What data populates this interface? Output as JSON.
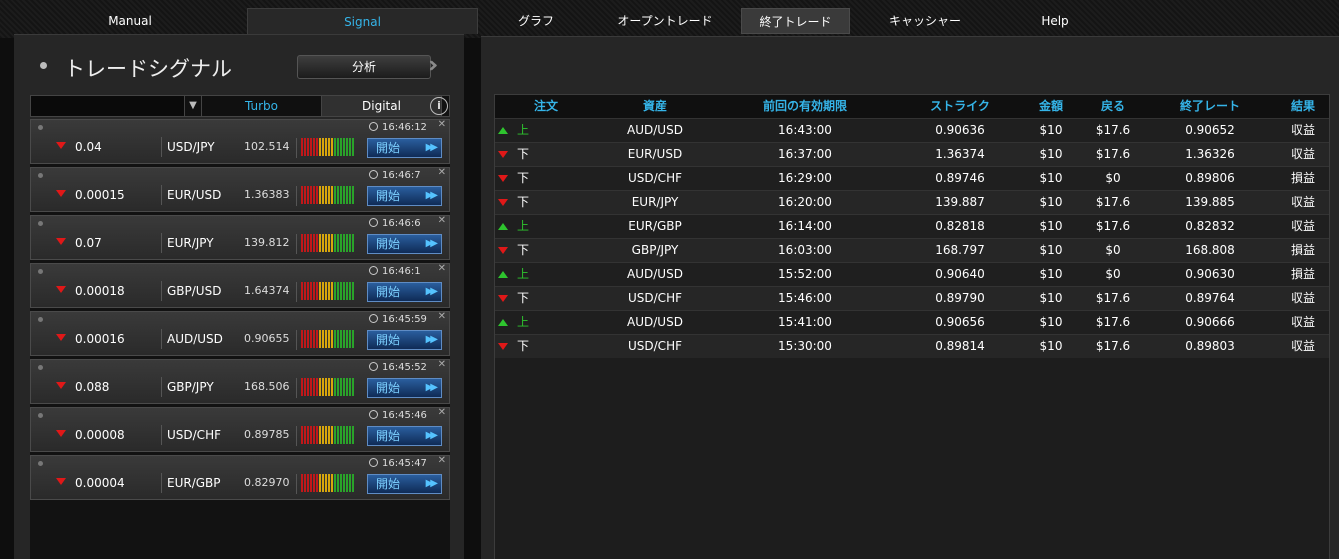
{
  "nav": {
    "tabs": [
      {
        "label": "Manual"
      },
      {
        "label": "Signal"
      },
      {
        "label": "グラフ"
      },
      {
        "label": "オープントレード"
      },
      {
        "label": "終了トレード"
      },
      {
        "label": "キャッシャー"
      },
      {
        "label": "Help"
      }
    ],
    "active_tab": "Signal",
    "selected_tab": "終了トレード"
  },
  "left_panel": {
    "title": "トレードシグナル",
    "analyze_label": "分析",
    "filter": {
      "selected": "",
      "turbo_label": "Turbo",
      "digital_label": "Digital",
      "info_label": "i"
    },
    "signals": [
      {
        "time": "16:46:12",
        "value": "0.04",
        "pair": "USD/JPY",
        "price": "102.514",
        "direction": "down",
        "start_label": "開始"
      },
      {
        "time": "16:46:7",
        "value": "0.00015",
        "pair": "EUR/USD",
        "price": "1.36383",
        "direction": "down",
        "start_label": "開始"
      },
      {
        "time": "16:46:6",
        "value": "0.07",
        "pair": "EUR/JPY",
        "price": "139.812",
        "direction": "down",
        "start_label": "開始"
      },
      {
        "time": "16:46:1",
        "value": "0.00018",
        "pair": "GBP/USD",
        "price": "1.64374",
        "direction": "down",
        "start_label": "開始"
      },
      {
        "time": "16:45:59",
        "value": "0.00016",
        "pair": "AUD/USD",
        "price": "0.90655",
        "direction": "down",
        "start_label": "開始"
      },
      {
        "time": "16:45:52",
        "value": "0.088",
        "pair": "GBP/JPY",
        "price": "168.506",
        "direction": "down",
        "start_label": "開始"
      },
      {
        "time": "16:45:46",
        "value": "0.00008",
        "pair": "USD/CHF",
        "price": "0.89785",
        "direction": "down",
        "start_label": "開始"
      },
      {
        "time": "16:45:47",
        "value": "0.00004",
        "pair": "EUR/GBP",
        "price": "0.82970",
        "direction": "down",
        "start_label": "開始"
      }
    ],
    "meter_colors": [
      "#c0181a",
      "#d8a60c",
      "#2aa32a"
    ]
  },
  "trades_table": {
    "headers": {
      "order": "注文",
      "asset": "資産",
      "expiry": "前回の有効期限",
      "strike": "ストライク",
      "amount": "金額",
      "return": "戻る",
      "final_rate": "終了レート",
      "result": "結果"
    },
    "rows": [
      {
        "dir": "up",
        "dir_label": "上",
        "asset": "AUD/USD",
        "expiry": "16:43:00",
        "strike": "0.90636",
        "amount": "$10",
        "return": "$17.6",
        "final_rate": "0.90652",
        "result": "収益"
      },
      {
        "dir": "down",
        "dir_label": "下",
        "asset": "EUR/USD",
        "expiry": "16:37:00",
        "strike": "1.36374",
        "amount": "$10",
        "return": "$17.6",
        "final_rate": "1.36326",
        "result": "収益"
      },
      {
        "dir": "down",
        "dir_label": "下",
        "asset": "USD/CHF",
        "expiry": "16:29:00",
        "strike": "0.89746",
        "amount": "$10",
        "return": "$0",
        "final_rate": "0.89806",
        "result": "損益"
      },
      {
        "dir": "down",
        "dir_label": "下",
        "asset": "EUR/JPY",
        "expiry": "16:20:00",
        "strike": "139.887",
        "amount": "$10",
        "return": "$17.6",
        "final_rate": "139.885",
        "result": "収益"
      },
      {
        "dir": "up",
        "dir_label": "上",
        "asset": "EUR/GBP",
        "expiry": "16:14:00",
        "strike": "0.82818",
        "amount": "$10",
        "return": "$17.6",
        "final_rate": "0.82832",
        "result": "収益"
      },
      {
        "dir": "down",
        "dir_label": "下",
        "asset": "GBP/JPY",
        "expiry": "16:03:00",
        "strike": "168.797",
        "amount": "$10",
        "return": "$0",
        "final_rate": "168.808",
        "result": "損益"
      },
      {
        "dir": "up",
        "dir_label": "上",
        "asset": "AUD/USD",
        "expiry": "15:52:00",
        "strike": "0.90640",
        "amount": "$10",
        "return": "$0",
        "final_rate": "0.90630",
        "result": "損益"
      },
      {
        "dir": "down",
        "dir_label": "下",
        "asset": "USD/CHF",
        "expiry": "15:46:00",
        "strike": "0.89790",
        "amount": "$10",
        "return": "$17.6",
        "final_rate": "0.89764",
        "result": "収益"
      },
      {
        "dir": "up",
        "dir_label": "上",
        "asset": "AUD/USD",
        "expiry": "15:41:00",
        "strike": "0.90656",
        "amount": "$10",
        "return": "$17.6",
        "final_rate": "0.90666",
        "result": "収益"
      },
      {
        "dir": "down",
        "dir_label": "下",
        "asset": "USD/CHF",
        "expiry": "15:30:00",
        "strike": "0.89814",
        "amount": "$10",
        "return": "$17.6",
        "final_rate": "0.89803",
        "result": "収益"
      }
    ]
  }
}
